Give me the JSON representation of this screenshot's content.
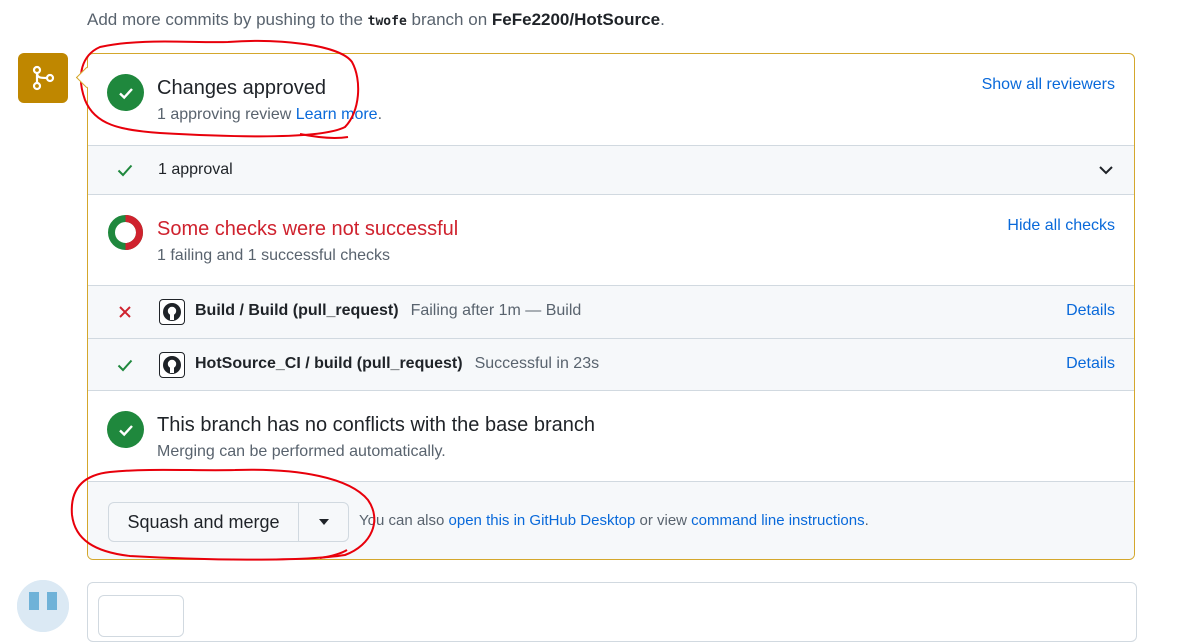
{
  "note": {
    "prefix": "Add more commits by pushing to the",
    "branch": "twofe",
    "middle": "branch on",
    "repo": "FeFe2200/HotSource",
    "suffix": "."
  },
  "approval": {
    "title": "Changes approved",
    "subtitle": "1 approving review",
    "learn_more": "Learn more",
    "period": ".",
    "show_reviewers": "Show all reviewers",
    "count_label": "1 approval"
  },
  "checks": {
    "title": "Some checks were not successful",
    "subtitle": "1 failing and 1 successful checks",
    "hide_label": "Hide all checks",
    "items": [
      {
        "name": "Build / Build (pull_request)",
        "desc": "Failing after 1m — Build",
        "details": "Details"
      },
      {
        "name": "HotSource_CI / build (pull_request)",
        "desc": "Successful in 23s",
        "details": "Details"
      }
    ]
  },
  "conflicts": {
    "title": "This branch has no conflicts with the base branch",
    "subtitle": "Merging can be performed automatically."
  },
  "merge": {
    "button": "Squash and merge",
    "hint_prefix": "You can also",
    "desktop_link": "open this in GitHub Desktop",
    "hint_middle": "or view",
    "cli_link": "command line instructions",
    "hint_suffix": "."
  },
  "colors": {
    "success": "#1f883d",
    "danger": "#cf222e",
    "attention": "#bf8700",
    "link": "#0969da",
    "annotation": "#e8000b"
  }
}
